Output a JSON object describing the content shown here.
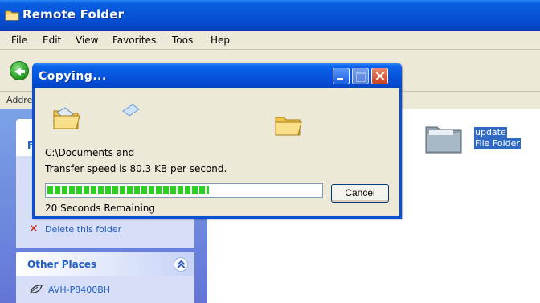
{
  "window": {
    "title": "Remote Folder"
  },
  "menu": [
    "File",
    "Edit",
    "View",
    "Favorites",
    "Toos",
    "Hep"
  ],
  "address": {
    "label": "Addre"
  },
  "left_pane": {
    "task_head_letter": "F",
    "delete_text": "Delete this folder",
    "other_places": {
      "title": "Other Places",
      "items": [
        "AVH-P8400BH"
      ]
    }
  },
  "content": {
    "folder": {
      "name": "update",
      "type": "File Folder"
    }
  },
  "dialog": {
    "title": "Copying...",
    "source_line": "C:\\Documents and",
    "speed_line": "Transfer speed is 80.3 KB per second.",
    "progress": 0.59,
    "remaining": "20 Seconds Remaining",
    "cancel_label": "Cancel"
  },
  "colors": {
    "xp_blue": "#0553d8",
    "progress_green": "#2bd021",
    "selection": "#316ac5"
  }
}
